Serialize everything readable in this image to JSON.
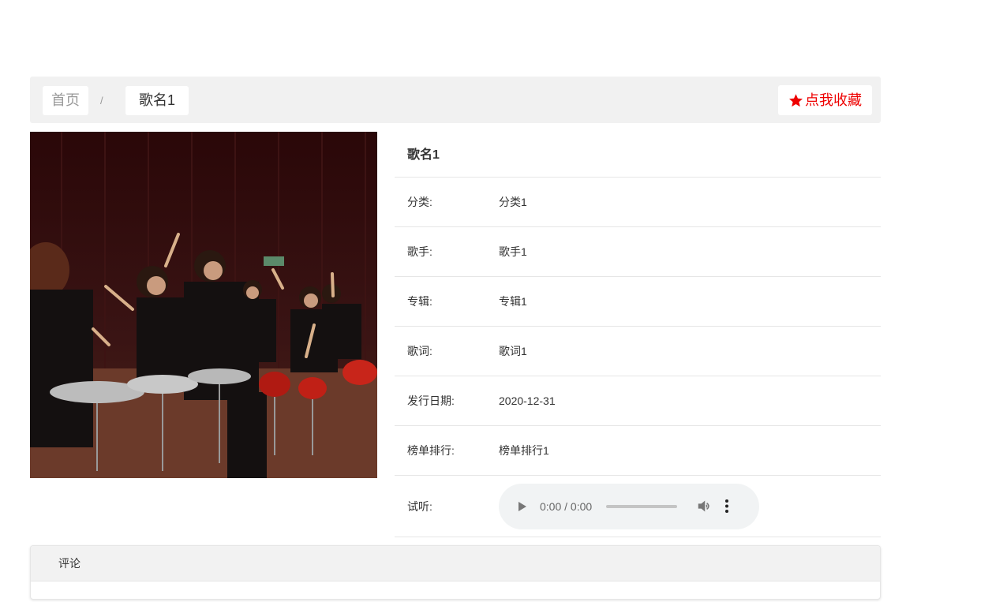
{
  "breadcrumb": {
    "home": "首页",
    "separator": "/",
    "current": "歌名1"
  },
  "favorite": {
    "label": "点我收藏",
    "icon": "star-icon",
    "color": "#ee0000"
  },
  "song": {
    "title": "歌名1",
    "fields": [
      {
        "label": "分类:",
        "value": "分类1"
      },
      {
        "label": "歌手:",
        "value": "歌手1"
      },
      {
        "label": "专辑:",
        "value": "专辑1"
      },
      {
        "label": "歌词:",
        "value": "歌词1"
      },
      {
        "label": "发行日期:",
        "value": "2020-12-31"
      },
      {
        "label": "榜单排行:",
        "value": "榜单排行1"
      }
    ],
    "audio": {
      "label": "试听:",
      "time": "0:00 / 0:00"
    }
  },
  "comments": {
    "title": "评论"
  }
}
